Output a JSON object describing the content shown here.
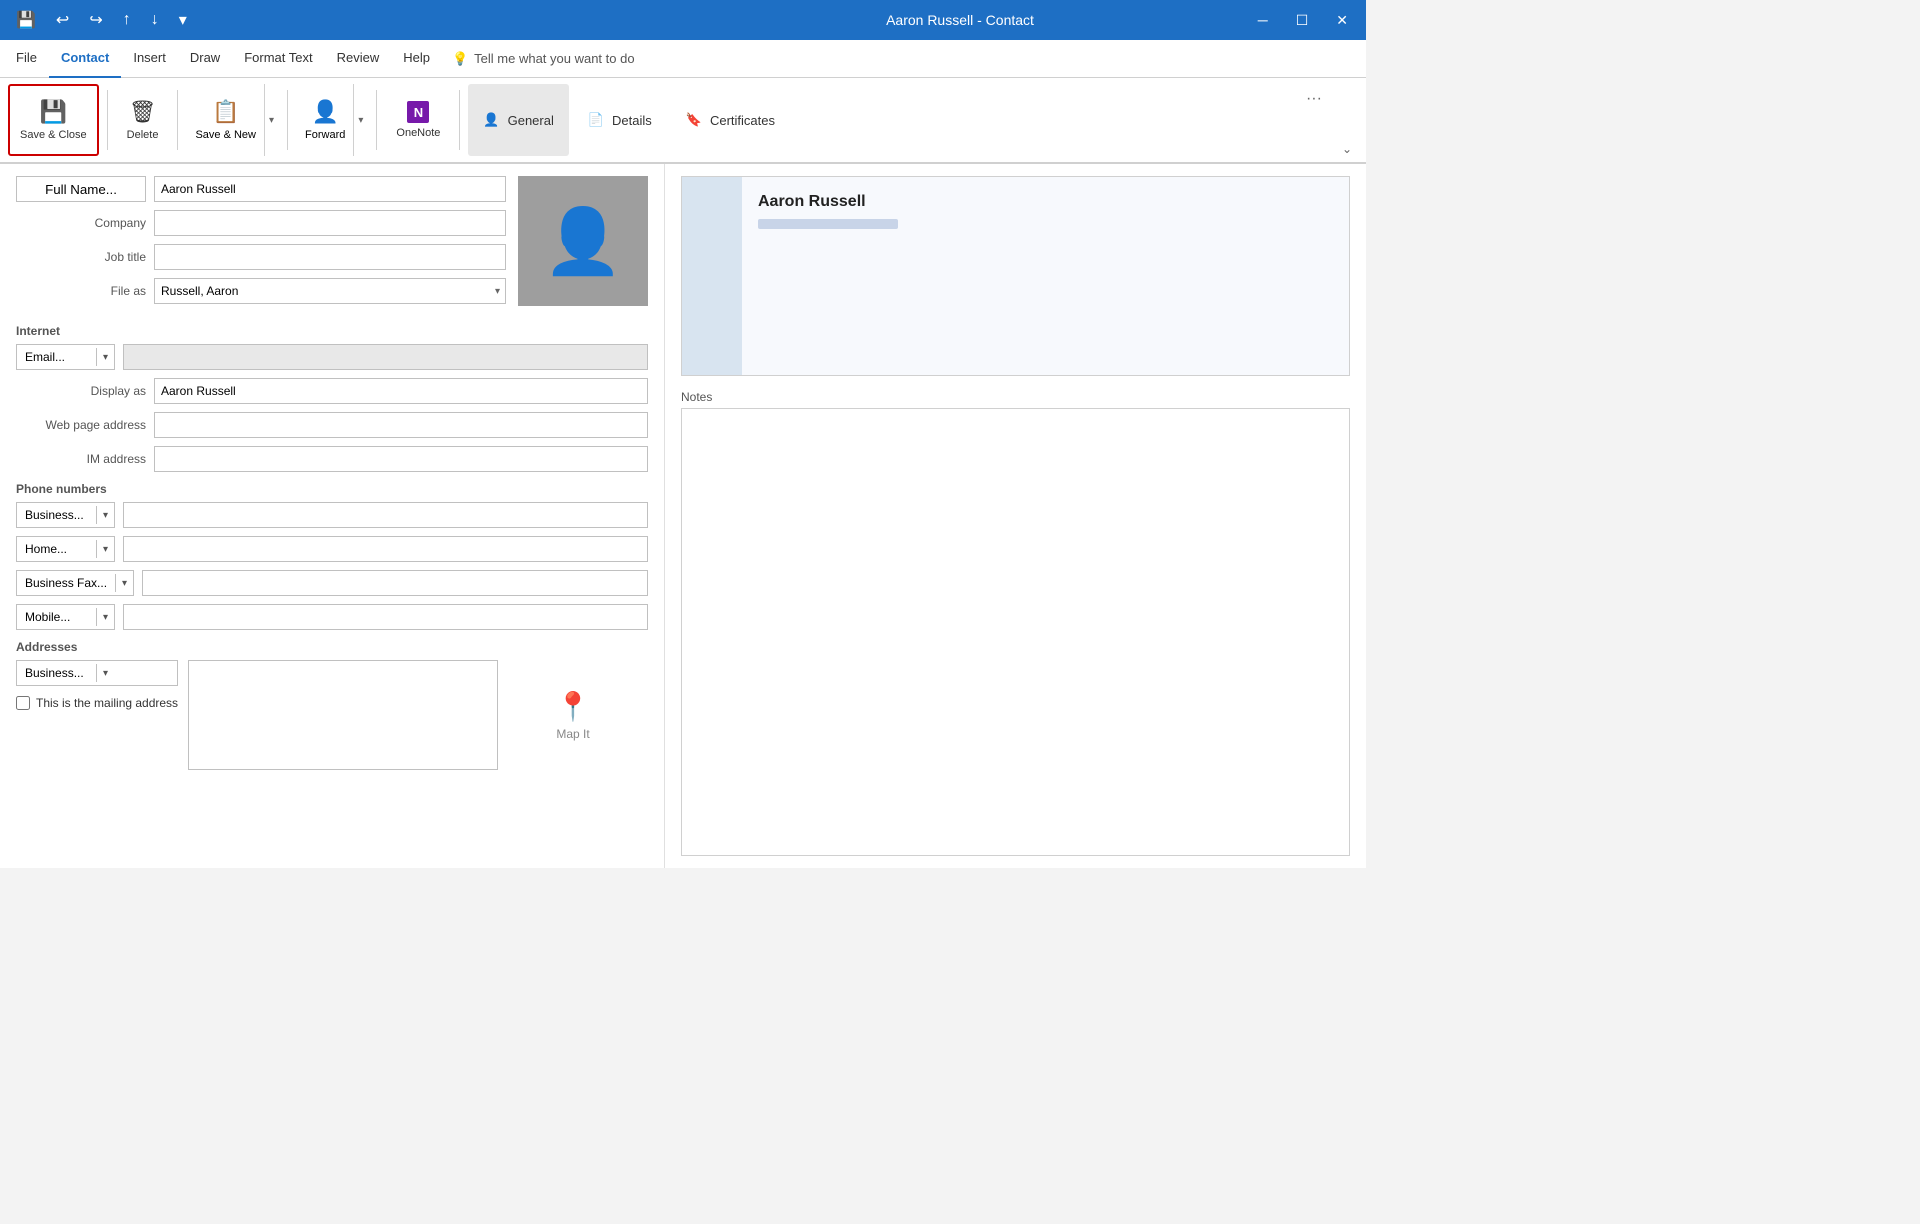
{
  "titlebar": {
    "title": "Aaron Russell - Contact",
    "minimize": "─",
    "restore": "☐",
    "close": "✕"
  },
  "menubar": {
    "items": [
      "File",
      "Contact",
      "Insert",
      "Draw",
      "Format Text",
      "Review",
      "Help"
    ],
    "active": "Contact",
    "tell_me": "Tell me what you want to do"
  },
  "ribbon": {
    "save_close": "Save & Close",
    "delete": "Delete",
    "save_new": "Save & New",
    "forward": "Forward",
    "onenote": "OneNote",
    "general": "General",
    "details": "Details",
    "certificates": "Certificates",
    "more": "···",
    "chevron": "⌄"
  },
  "form": {
    "full_name_btn": "Full Name...",
    "full_name_value": "Aaron Russell",
    "company_label": "Company",
    "company_value": "",
    "job_title_label": "Job title",
    "job_title_value": "",
    "file_as_label": "File as",
    "file_as_value": "Russell, Aaron",
    "internet_label": "Internet",
    "email_btn": "Email...",
    "email_value": "",
    "display_as_label": "Display as",
    "display_as_value": "Aaron Russell",
    "webpage_label": "Web page address",
    "webpage_value": "",
    "im_label": "IM address",
    "im_value": "",
    "phone_label": "Phone numbers",
    "business_btn": "Business...",
    "business_value": "",
    "home_btn": "Home...",
    "home_value": "",
    "bizfax_btn": "Business Fax...",
    "bizfax_value": "",
    "mobile_btn": "Mobile...",
    "mobile_value": "",
    "addresses_label": "Addresses",
    "address_btn": "Business...",
    "address_value": "",
    "mailing_check_label": "This is the mailing address",
    "map_it_label": "Map It"
  },
  "contact_card": {
    "name": "Aaron Russell",
    "email_blur": ""
  },
  "notes_label": "Notes"
}
